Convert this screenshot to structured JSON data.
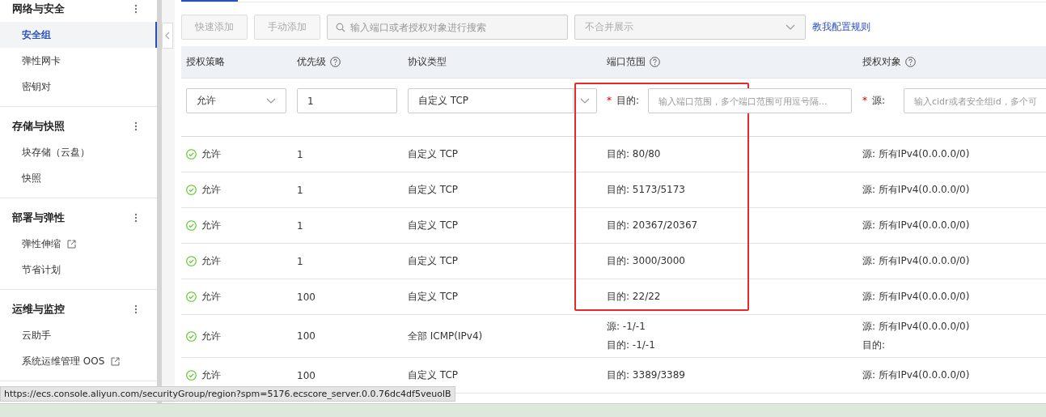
{
  "sidebar": {
    "groups": [
      {
        "title": "网络与安全",
        "items": [
          {
            "label": "安全组",
            "selected": true,
            "external": false
          },
          {
            "label": "弹性网卡",
            "selected": false,
            "external": false
          },
          {
            "label": "密钥对",
            "selected": false,
            "external": false
          }
        ]
      },
      {
        "title": "存储与快照",
        "items": [
          {
            "label": "块存储（云盘）",
            "selected": false,
            "external": false
          },
          {
            "label": "快照",
            "selected": false,
            "external": false
          }
        ]
      },
      {
        "title": "部署与弹性",
        "items": [
          {
            "label": "弹性伸缩",
            "selected": false,
            "external": true
          },
          {
            "label": "节省计划",
            "selected": false,
            "external": false
          }
        ]
      },
      {
        "title": "运维与监控",
        "items": [
          {
            "label": "云助手",
            "selected": false,
            "external": false
          },
          {
            "label": "系统运维管理 OOS",
            "selected": false,
            "external": true
          }
        ]
      }
    ]
  },
  "toolbar": {
    "buttons": [
      {
        "label": "快速添加",
        "disabled": true
      },
      {
        "label": "手动添加",
        "disabled": true
      }
    ],
    "search": {
      "placeholder": "输入端口或者授权对象进行搜索"
    },
    "merge_select": {
      "value": "不合并展示"
    },
    "help_link": "教我配置规则"
  },
  "table": {
    "columns": [
      {
        "label": "授权策略",
        "help": false
      },
      {
        "label": "优先级",
        "help": true
      },
      {
        "label": "协议类型",
        "help": false
      },
      {
        "label": "端口范围",
        "help": true
      },
      {
        "label": "授权对象",
        "help": true
      }
    ],
    "edit_row": {
      "required_mark": "*",
      "policy": "允许",
      "priority": "1",
      "protocol": "自定义 TCP",
      "port_label": "目的:",
      "port_placeholder": "输入端口范围，多个端口范围可用逗号隔...",
      "source_label": "源:",
      "source_placeholder": "输入cidr或者安全组id，多个可"
    },
    "rows": [
      {
        "policy": "允许",
        "priority": "1",
        "protocol": "自定义 TCP",
        "port": [
          "目的: 80/80"
        ],
        "object": [
          "源: 所有IPv4(0.0.0.0/0)"
        ]
      },
      {
        "policy": "允许",
        "priority": "1",
        "protocol": "自定义 TCP",
        "port": [
          "目的: 5173/5173"
        ],
        "object": [
          "源: 所有IPv4(0.0.0.0/0)"
        ]
      },
      {
        "policy": "允许",
        "priority": "1",
        "protocol": "自定义 TCP",
        "port": [
          "目的: 20367/20367"
        ],
        "object": [
          "源: 所有IPv4(0.0.0.0/0)"
        ]
      },
      {
        "policy": "允许",
        "priority": "1",
        "protocol": "自定义 TCP",
        "port": [
          "目的: 3000/3000"
        ],
        "object": [
          "源: 所有IPv4(0.0.0.0/0)"
        ]
      },
      {
        "policy": "允许",
        "priority": "100",
        "protocol": "自定义 TCP",
        "port": [
          "目的: 22/22"
        ],
        "object": [
          "源: 所有IPv4(0.0.0.0/0)"
        ]
      },
      {
        "policy": "允许",
        "priority": "100",
        "protocol": "全部 ICMP(IPv4)",
        "port": [
          "源: -1/-1",
          "目的: -1/-1"
        ],
        "object": [
          "源: 所有IPv4(0.0.0.0/0)",
          "目的:"
        ]
      },
      {
        "policy": "允许",
        "priority": "100",
        "protocol": "自定义 TCP",
        "port": [
          "目的: 3389/3389"
        ],
        "object": [
          "源: 所有IPv4(0.0.0.0/0)"
        ]
      }
    ]
  },
  "status_url": "https://ecs.console.aliyun.com/securityGroup/region?spm=5176.ecscore_server.0.0.76dc4df5veuolB"
}
